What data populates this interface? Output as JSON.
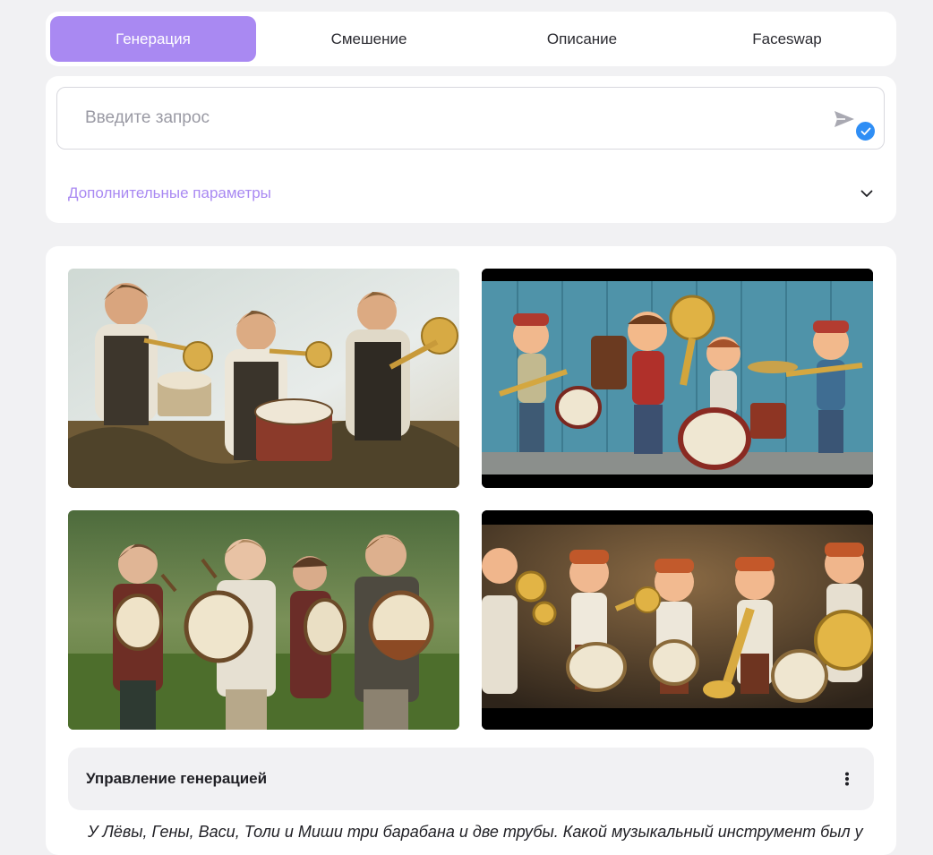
{
  "tabs": [
    {
      "label": "Генерация",
      "active": true
    },
    {
      "label": "Смешение",
      "active": false
    },
    {
      "label": "Описание",
      "active": false
    },
    {
      "label": "Faceswap",
      "active": false
    }
  ],
  "query": {
    "placeholder": "Введите запрос",
    "value": "",
    "send_icon": "send-icon",
    "badge_icon": "check-icon"
  },
  "params": {
    "label": "Дополнительные параметры",
    "icon": "chevron-down-icon"
  },
  "gallery": {
    "images": [
      {
        "name": "boys-trumpets-drum-painting"
      },
      {
        "name": "cartoon-boys-band-blue-wall"
      },
      {
        "name": "boys-drums-meadow-photo"
      },
      {
        "name": "cartoon-boys-brass-band-street"
      }
    ]
  },
  "control": {
    "title": "Управление генерацией",
    "menu_icon": "kebab-menu-icon"
  },
  "prompt": "У Лёвы, Гены, Васи, Толи и Миши три барабана и две трубы. Какой музыкальный инструмент был у",
  "colors": {
    "accent": "#a989f2",
    "badge": "#2f8ef5",
    "background": "#f1f1f3",
    "card": "#ffffff"
  }
}
